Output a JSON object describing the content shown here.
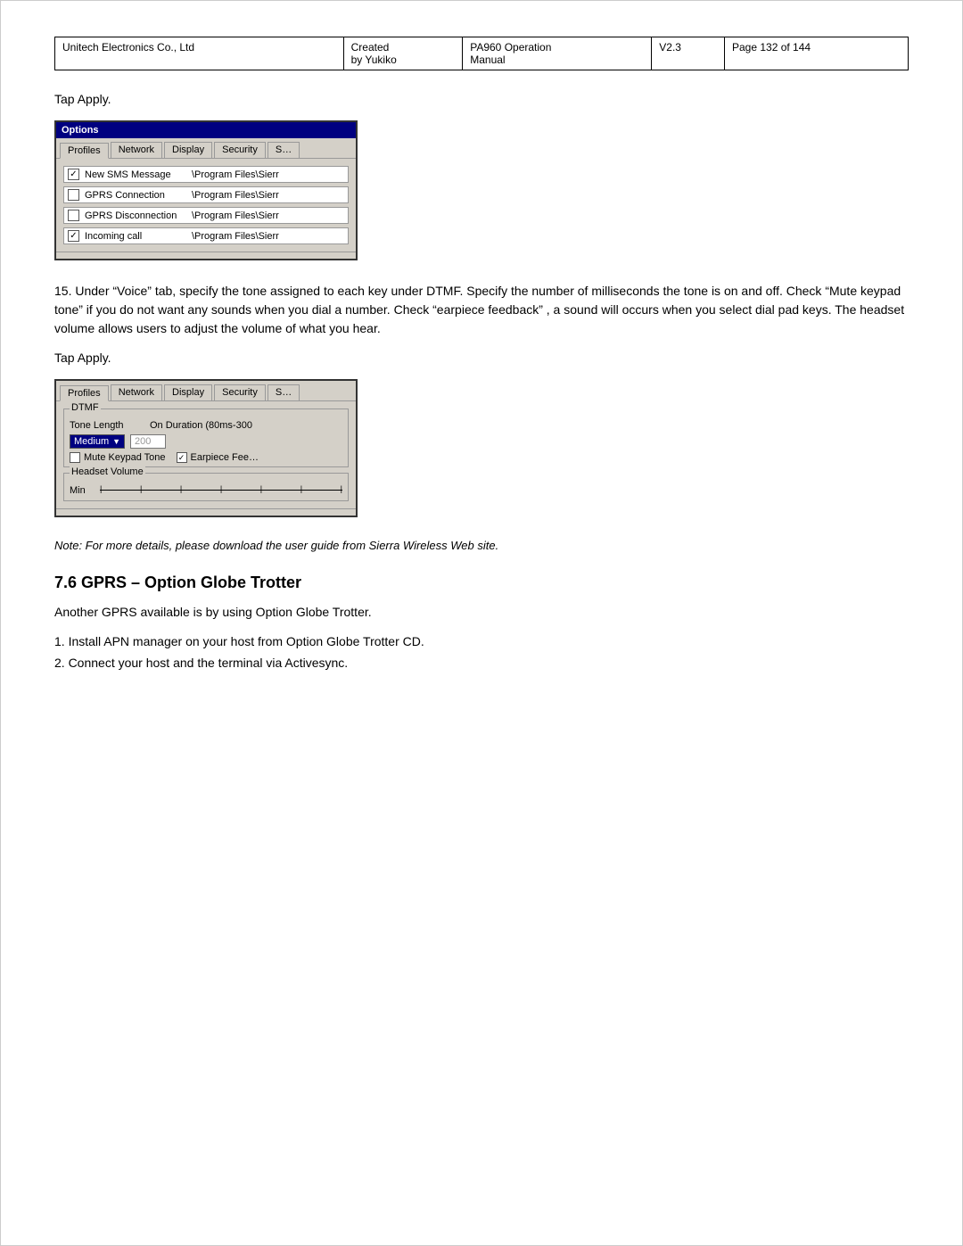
{
  "header": {
    "company": "Unitech Electronics Co., Ltd",
    "created_label": "Created",
    "created_by": "by Yukiko",
    "product": "PA960 Operation",
    "manual": "Manual",
    "version": "V2.3",
    "page": "Page 132 of 144"
  },
  "tap_apply_1": "Tap Apply.",
  "tap_apply_2": "Tap Apply.",
  "dialog1": {
    "title": "Options",
    "tabs": [
      "Profiles",
      "Network",
      "Display",
      "Security",
      "S…"
    ],
    "active_tab": "Profiles",
    "rows": [
      {
        "label": "New SMS Message",
        "path": "\\Program Files\\Sierr",
        "checked": true
      },
      {
        "label": "GPRS Connection",
        "path": "\\Program Files\\Sierr",
        "checked": false
      },
      {
        "label": "GPRS Disconnection",
        "path": "\\Program Files\\Sierr",
        "checked": false
      },
      {
        "label": "Incoming call",
        "path": "\\Program Files\\Sierr",
        "checked": true
      }
    ]
  },
  "body_text": "15. Under “Voice” tab, specify the tone assigned to each key under DTMF. Specify the number of milliseconds the tone is on and off. Check “Mute keypad tone” if you do not want any sounds when you dial a number. Check “earpiece feedback” , a sound will occurs when you select dial pad keys. The headset volume allows users to adjust the volume of what you hear.",
  "dialog2": {
    "tabs": [
      "Profiles",
      "Network",
      "Display",
      "Security",
      "S…"
    ],
    "dtmf_group_label": "DTMF",
    "tone_length_label": "Tone Length",
    "on_duration_label": "On Duration (80ms-300",
    "select_value": "Medium",
    "input_value": "200",
    "mute_label": "Mute Keypad Tone",
    "mute_checked": false,
    "earpiece_label": "Earpiece Fee…",
    "earpiece_checked": true,
    "headset_label": "Headset Volume",
    "min_label": "Min",
    "slider_ticks": [
      "’",
      "’",
      "’",
      "’",
      "’",
      "’",
      "’"
    ]
  },
  "italic_note": "Note: For more details, please download the user guide from Sierra Wireless Web site.",
  "section_heading": "7.6   GPRS – Option Globe Trotter",
  "gprs_intro": "Another GPRS available is by using Option Globe Trotter.",
  "list_items": [
    "1.  Install APN manager on your host from Option Globe Trotter CD.",
    "2.  Connect your host and the terminal via Activesync."
  ]
}
